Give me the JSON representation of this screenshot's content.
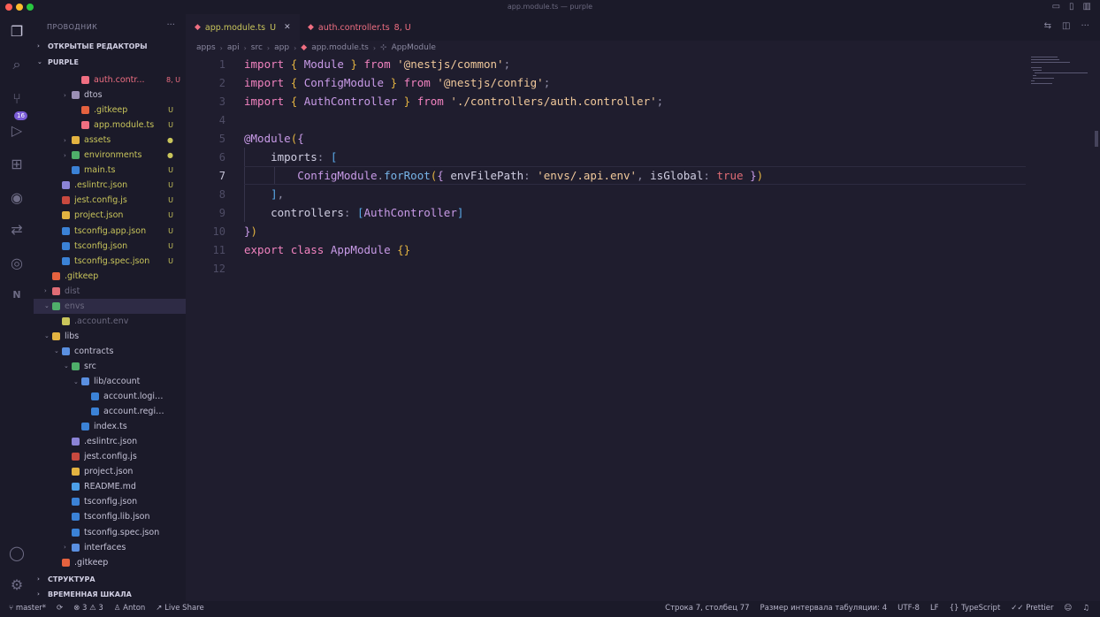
{
  "window": {
    "title": "app.module.ts — purple"
  },
  "activity_bar": {
    "extensions_badge": "16"
  },
  "explorer": {
    "header": "ПРОВОДНИК",
    "open_editors_label": "ОТКРЫТЫЕ РЕДАКТОРЫ",
    "project_label": "PURPLE",
    "rows": [
      {
        "label": "auth.contr...",
        "status": "8, U",
        "depth": 3,
        "kind": "ts-red",
        "color": "#f06f82",
        "chev": ""
      },
      {
        "label": "dtos",
        "status": "",
        "depth": 2,
        "kind": "folder",
        "color": "#c4c2d6",
        "chev": "›"
      },
      {
        "label": ".gitkeep",
        "status": "U",
        "depth": 3,
        "kind": "git",
        "color": "#c9c55b",
        "chev": ""
      },
      {
        "label": "app.module.ts",
        "status": "U",
        "depth": 3,
        "kind": "ts-red",
        "color": "#c9c55b",
        "chev": ""
      },
      {
        "label": "assets",
        "status": "●",
        "depth": 2,
        "kind": "folder-y",
        "color": "#c9c55b",
        "chev": "›"
      },
      {
        "label": "environments",
        "status": "●",
        "depth": 2,
        "kind": "folder-g",
        "color": "#c9c55b",
        "chev": "›"
      },
      {
        "label": "main.ts",
        "status": "U",
        "depth": 2,
        "kind": "ts",
        "color": "#c9c55b",
        "chev": ""
      },
      {
        "label": ".eslintrc.json",
        "status": "U",
        "depth": 1,
        "kind": "eslint",
        "color": "#c9c55b",
        "chev": ""
      },
      {
        "label": "jest.config.js",
        "status": "U",
        "depth": 1,
        "kind": "jest",
        "color": "#c9c55b",
        "chev": ""
      },
      {
        "label": "project.json",
        "status": "U",
        "depth": 1,
        "kind": "json",
        "color": "#c9c55b",
        "chev": ""
      },
      {
        "label": "tsconfig.app.json",
        "status": "U",
        "depth": 1,
        "kind": "tsc",
        "color": "#c9c55b",
        "chev": ""
      },
      {
        "label": "tsconfig.json",
        "status": "U",
        "depth": 1,
        "kind": "tsc",
        "color": "#c9c55b",
        "chev": ""
      },
      {
        "label": "tsconfig.spec.json",
        "status": "U",
        "depth": 1,
        "kind": "tsc",
        "color": "#c9c55b",
        "chev": ""
      },
      {
        "label": ".gitkeep",
        "status": "",
        "depth": 0,
        "kind": "git",
        "color": "#c9c55b",
        "chev": ""
      },
      {
        "label": "dist",
        "status": "",
        "depth": 0,
        "kind": "folder-r",
        "color": "#6c6a80",
        "chev": "›"
      },
      {
        "label": "envs",
        "status": "",
        "depth": 0,
        "kind": "folder-g",
        "color": "#6c6a80",
        "chev": "⌄",
        "selected": true
      },
      {
        "label": ".account.env",
        "status": "",
        "depth": 1,
        "kind": "env",
        "color": "#6c6a80",
        "chev": ""
      },
      {
        "label": "libs",
        "status": "",
        "depth": 0,
        "kind": "folder-y",
        "color": "#c4c2d6",
        "chev": "⌄"
      },
      {
        "label": "contracts",
        "status": "",
        "depth": 1,
        "kind": "folder-b",
        "color": "#c4c2d6",
        "chev": "⌄"
      },
      {
        "label": "src",
        "status": "",
        "depth": 2,
        "kind": "folder-g",
        "color": "#c4c2d6",
        "chev": "⌄"
      },
      {
        "label": "lib/account",
        "status": "",
        "depth": 3,
        "kind": "folder-b",
        "color": "#c4c2d6",
        "chev": "⌄"
      },
      {
        "label": "account.login.ts",
        "status": "",
        "depth": 4,
        "kind": "ts",
        "color": "#c4c2d6",
        "chev": ""
      },
      {
        "label": "account.register.ts",
        "status": "",
        "depth": 4,
        "kind": "ts",
        "color": "#c4c2d6",
        "chev": ""
      },
      {
        "label": "index.ts",
        "status": "",
        "depth": 3,
        "kind": "ts",
        "color": "#c4c2d6",
        "chev": ""
      },
      {
        "label": ".eslintrc.json",
        "status": "",
        "depth": 2,
        "kind": "eslint",
        "color": "#c4c2d6",
        "chev": ""
      },
      {
        "label": "jest.config.js",
        "status": "",
        "depth": 2,
        "kind": "jest",
        "color": "#c4c2d6",
        "chev": ""
      },
      {
        "label": "project.json",
        "status": "",
        "depth": 2,
        "kind": "json",
        "color": "#c4c2d6",
        "chev": ""
      },
      {
        "label": "README.md",
        "status": "",
        "depth": 2,
        "kind": "info",
        "color": "#c4c2d6",
        "chev": ""
      },
      {
        "label": "tsconfig.json",
        "status": "",
        "depth": 2,
        "kind": "tsc",
        "color": "#c4c2d6",
        "chev": ""
      },
      {
        "label": "tsconfig.lib.json",
        "status": "",
        "depth": 2,
        "kind": "tsc",
        "color": "#c4c2d6",
        "chev": ""
      },
      {
        "label": "tsconfig.spec.json",
        "status": "",
        "depth": 2,
        "kind": "tsc",
        "color": "#c4c2d6",
        "chev": ""
      },
      {
        "label": "interfaces",
        "status": "",
        "depth": 2,
        "kind": "folder-b",
        "color": "#c4c2d6",
        "chev": "›"
      },
      {
        "label": ".gitkeep",
        "status": "",
        "depth": 1,
        "kind": "git",
        "color": "#c4c2d6",
        "chev": ""
      }
    ],
    "outline_label": "СТРУКТУРА",
    "timeline_label": "ВРЕМЕННАЯ ШКАЛА"
  },
  "tabs": [
    {
      "label": "app.module.ts",
      "status": "U",
      "active": true
    },
    {
      "label": "auth.controller.ts",
      "status": "8, U",
      "active": false
    }
  ],
  "breadcrumb": [
    "apps",
    "api",
    "src",
    "app",
    "app.module.ts",
    "AppModule"
  ],
  "code_lines": [
    "1",
    "2",
    "3",
    "4",
    "5",
    "6",
    "7",
    "8",
    "9",
    "10",
    "11",
    "12"
  ],
  "code": {
    "l1": {
      "import": "import",
      "name": "Module",
      "from": "from",
      "path": "'@nestjs/common'"
    },
    "l2": {
      "import": "import",
      "name": "ConfigModule",
      "from": "from",
      "path": "'@nestjs/config'"
    },
    "l3": {
      "import": "import",
      "name": "AuthController",
      "from": "from",
      "path": "'./controllers/auth.controller'"
    },
    "l5": {
      "decorator": "@Module"
    },
    "l6": {
      "key": "imports"
    },
    "l7": {
      "obj": "ConfigModule",
      "method": "forRoot",
      "k1": "envFilePath",
      "v1": "'envs/.api.env'",
      "k2": "isGlobal",
      "v2": "true"
    },
    "l9": {
      "key": "controllers",
      "val": "AuthController"
    },
    "l11": {
      "export": "export",
      "class": "class",
      "name": "AppModule"
    }
  },
  "statusbar": {
    "branch": "master*",
    "sync": "⟳",
    "problems": "⊗ 3 ⚠ 3",
    "user": "Anton",
    "live_share": "Live Share",
    "position": "Строка 7, столбец 77",
    "indent": "Размер интервала табуляции: 4",
    "encoding": "UTF-8",
    "eol": "LF",
    "language": "TypeScript",
    "formatter": "Prettier"
  }
}
